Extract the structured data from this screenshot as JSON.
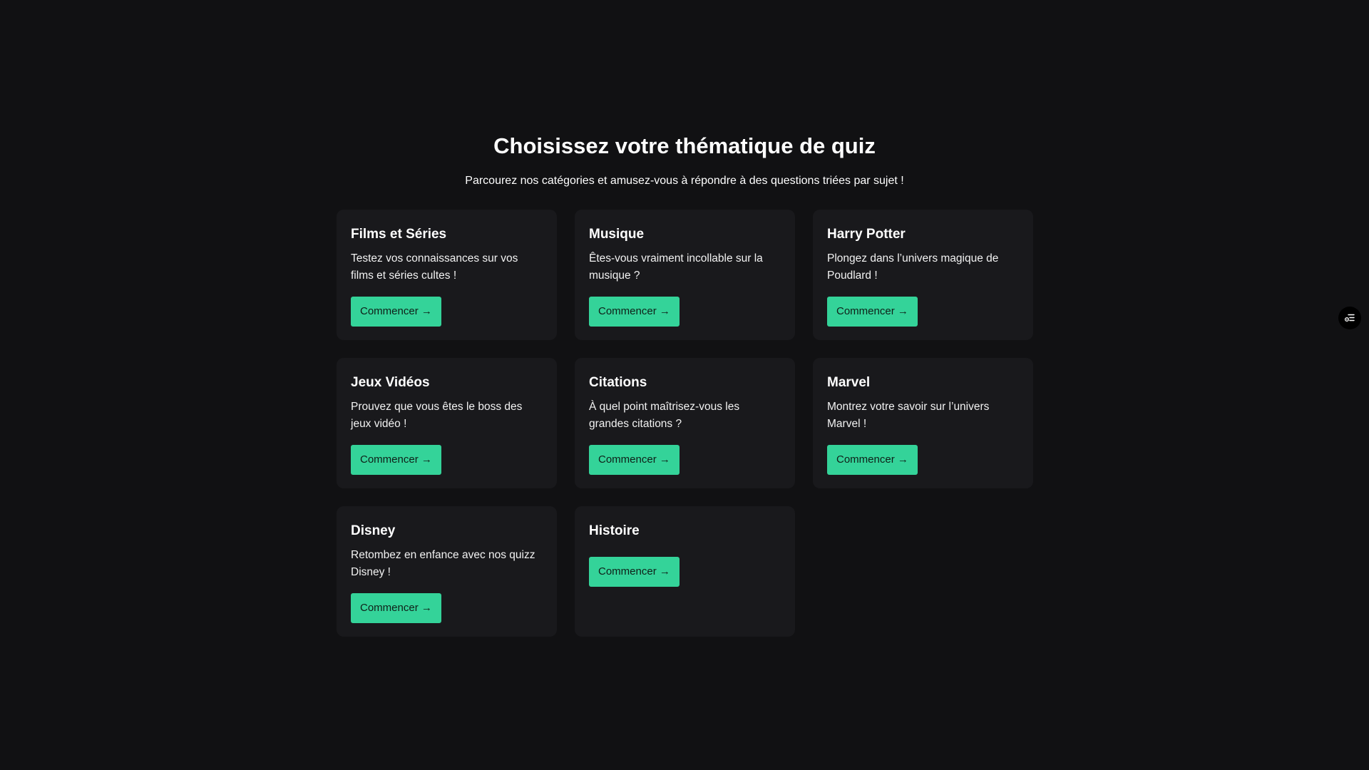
{
  "header": {
    "title": "Choisissez votre thématique de quiz",
    "subtitle": "Parcourez nos catégories et amusez-vous à répondre à des questions triées par sujet !"
  },
  "categories": [
    {
      "title": "Films et Séries",
      "description": "Testez vos connaissances sur vos films et séries cultes !",
      "button": "Commencer →"
    },
    {
      "title": "Musique",
      "description": "Êtes-vous vraiment incollable sur la musique ?",
      "button": "Commencer →"
    },
    {
      "title": "Harry Potter",
      "description": "Plongez dans l’univers magique de Poudlard !",
      "button": "Commencer →"
    },
    {
      "title": "Jeux Vidéos",
      "description": "Prouvez que vous êtes le boss des jeux vidéo !",
      "button": "Commencer →"
    },
    {
      "title": "Citations",
      "description": "À quel point maîtrisez-vous les grandes citations ?",
      "button": "Commencer →"
    },
    {
      "title": "Marvel",
      "description": "Montrez votre savoir sur l’univers Marvel !",
      "button": "Commencer →"
    },
    {
      "title": "Disney",
      "description": "Retombez en enfance avec nos quizz Disney !",
      "button": "Commencer →"
    },
    {
      "title": "Histoire",
      "description": "",
      "button": "Commencer →"
    }
  ],
  "side_widget": {
    "icon": "settings-list-icon"
  },
  "colors": {
    "background": "#111113",
    "card": "#19191c",
    "accent": "#34d399"
  }
}
